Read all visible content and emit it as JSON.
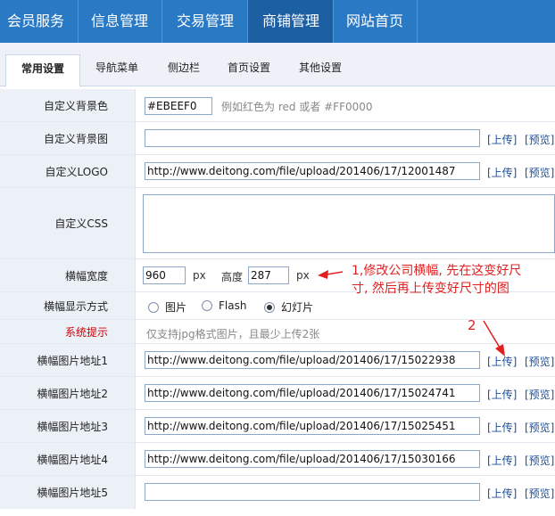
{
  "topnav": {
    "items": [
      "会员服务",
      "信息管理",
      "交易管理",
      "商铺管理",
      "网站首页"
    ],
    "active_index": 3
  },
  "subnav": {
    "tabs": [
      "常用设置",
      "导航菜单",
      "侧边栏",
      "首页设置",
      "其他设置"
    ],
    "active_index": 0
  },
  "form": {
    "bg_color": {
      "label": "自定义背景色",
      "value": "#EBEEF0",
      "hint": "例如红色为 red 或者 #FF0000"
    },
    "bg_image": {
      "label": "自定义背景图",
      "value": "",
      "upload": "[上传]",
      "preview": "[预览]"
    },
    "logo": {
      "label": "自定义LOGO",
      "value": "http://www.deitong.com/file/upload/201406/17/12001487",
      "upload": "[上传]",
      "preview": "[预览]"
    },
    "css": {
      "label": "自定义CSS",
      "value": ""
    },
    "banner_size": {
      "label": "横幅宽度",
      "width": "960",
      "width_unit": "px",
      "height_label": "高度",
      "height": "287",
      "height_unit": "px"
    },
    "banner_mode": {
      "label": "横幅显示方式",
      "options": [
        "图片",
        "Flash",
        "幻灯片"
      ],
      "selected_index": 2
    },
    "system_tip": {
      "label": "系统提示",
      "text": "仅支持jpg格式图片，且最少上传2张"
    },
    "banners": [
      {
        "label": "横幅图片地址1",
        "value": "http://www.deitong.com/file/upload/201406/17/15022938",
        "upload": "[上传]",
        "preview": "[预览]"
      },
      {
        "label": "横幅图片地址2",
        "value": "http://www.deitong.com/file/upload/201406/17/15024741",
        "upload": "[上传]",
        "preview": "[预览]"
      },
      {
        "label": "横幅图片地址3",
        "value": "http://www.deitong.com/file/upload/201406/17/15025451",
        "upload": "[上传]",
        "preview": "[预览]"
      },
      {
        "label": "横幅图片地址4",
        "value": "http://www.deitong.com/file/upload/201406/17/15030166",
        "upload": "[上传]",
        "preview": "[预览]"
      },
      {
        "label": "横幅图片地址5",
        "value": "",
        "upload": "[上传]",
        "preview": "[预览]"
      }
    ]
  },
  "annotations": {
    "note1_line1": "1,修改公司横幅, 先在这变好尺",
    "note1_line2": "寸, 然后再上传变好尺寸的图",
    "note2": "2",
    "arrow_color": "#e02020"
  }
}
